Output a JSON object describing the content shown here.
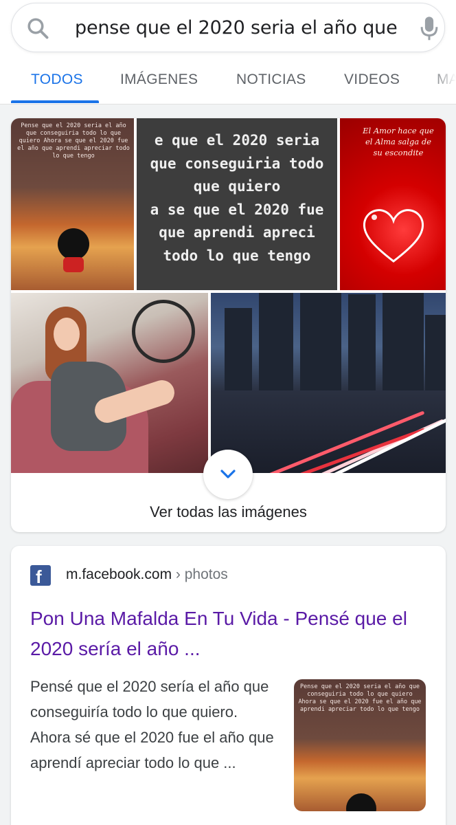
{
  "search": {
    "query": "pense que el 2020 seria el año que"
  },
  "tabs": [
    {
      "label": "TODOS",
      "active": true
    },
    {
      "label": "IMÁGENES",
      "active": false
    },
    {
      "label": "NOTICIAS",
      "active": false
    },
    {
      "label": "VIDEOS",
      "active": false
    },
    {
      "label": "MA",
      "active": false
    }
  ],
  "images": {
    "thumb1_text": "Pense que el 2020 seria el año que conseguiria todo lo que quiero Ahora se que el 2020 fue el año que aprendi apreciar todo lo que tengo",
    "thumb2_lines": [
      "e que el 2020 seria",
      "que conseguiria todo",
      "que quiero",
      "a se que el 2020 fue",
      "que aprendi apreci",
      "todo lo que tengo"
    ],
    "thumb3_text": "El Amor hace que el Alma salga de su escondite",
    "see_all_label": "Ver todas las imágenes"
  },
  "result": {
    "source_icon": "facebook-icon",
    "domain": "m.facebook.com",
    "crumb": " › photos",
    "title": "Pon Una Mafalda En Tu Vida - Pensé que el 2020 sería el año ...",
    "snippet": "Pensé que el 2020 sería el año que conseguiría todo lo que quiero. Ahora sé que el 2020 fue el año que aprendí apreciar todo lo que ...",
    "thumb_text": "Pense que el 2020 seria el año que conseguiria todo lo que quiero Ahora se que el 2020 fue el año que aprendi apreciar todo lo que tengo"
  },
  "colors": {
    "accent": "#1a73e8",
    "visited_link": "#5a1aa6",
    "facebook": "#3b5998"
  }
}
